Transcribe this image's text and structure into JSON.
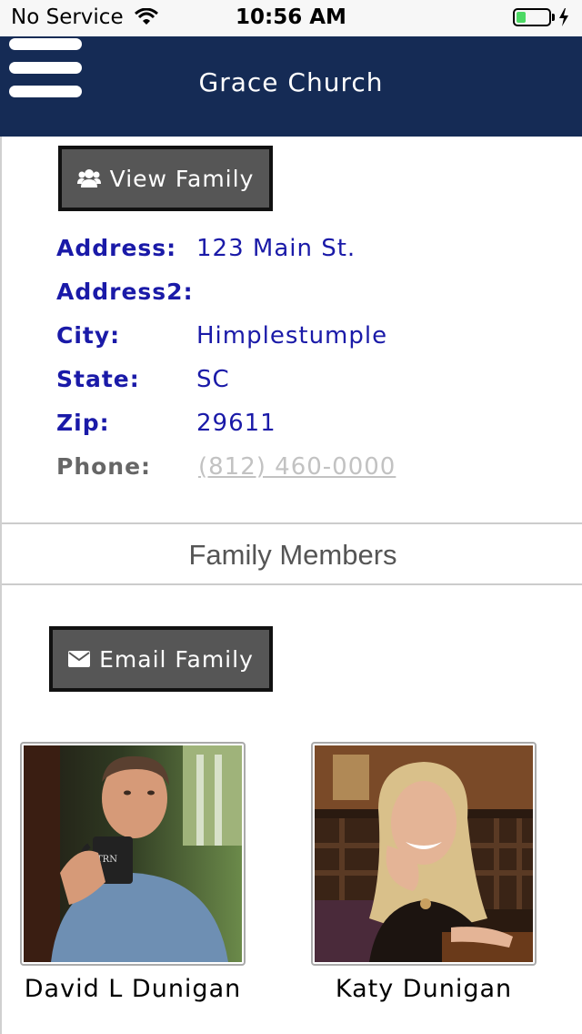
{
  "status_bar": {
    "carrier": "No Service",
    "time": "10:56 AM",
    "battery_level": 0.3
  },
  "header": {
    "title": "Grace Church"
  },
  "actions": {
    "view_family_label": "View Family",
    "email_family_label": "Email Family"
  },
  "address_info": {
    "address_label": "Address:",
    "address_value": "123 Main St.",
    "address2_label": "Address2:",
    "address2_value": "",
    "city_label": "City:",
    "city_value": "Himplestumple",
    "state_label": "State:",
    "state_value": "SC",
    "zip_label": "Zip:",
    "zip_value": "29611",
    "phone_label": "Phone:",
    "phone_value": "(812) 460-0000"
  },
  "family_section": {
    "heading": "Family Members",
    "members": [
      {
        "name": "David L Dunigan"
      },
      {
        "name": "Katy Dunigan"
      }
    ]
  },
  "colors": {
    "header_bg": "#152b55",
    "label_blue": "#1a1aa8",
    "button_bg": "#565656",
    "battery_green": "#4cd964"
  }
}
